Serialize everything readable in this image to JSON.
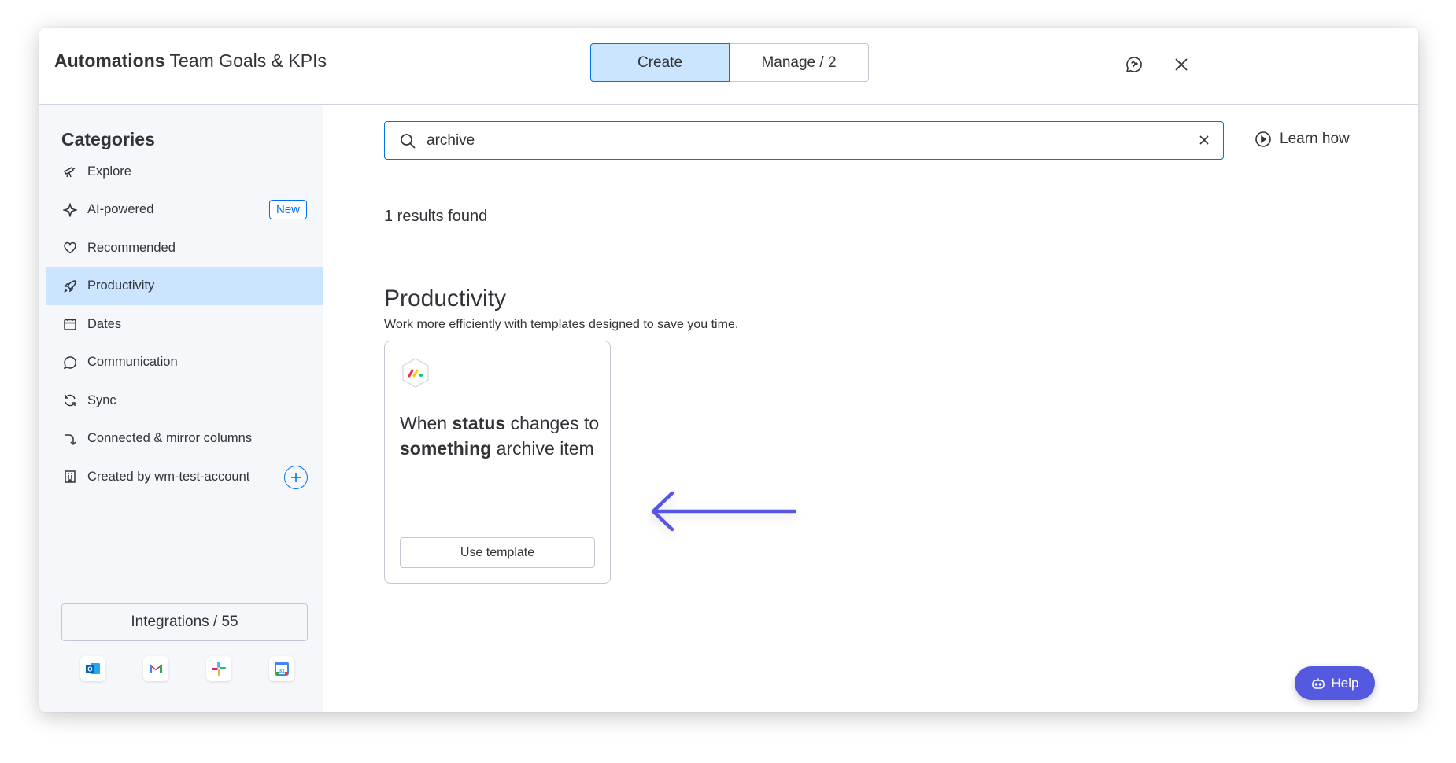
{
  "header": {
    "title_bold": "Automations",
    "title_board": "Team Goals & KPIs",
    "tabs": [
      {
        "label": "Create"
      },
      {
        "label": "Manage / 2"
      }
    ]
  },
  "sidebar": {
    "title": "Categories",
    "items": [
      {
        "label": "Explore",
        "icon": "telescope-icon"
      },
      {
        "label": "AI-powered",
        "icon": "sparkle-icon",
        "badge": "New"
      },
      {
        "label": "Recommended",
        "icon": "heart-icon"
      },
      {
        "label": "Productivity",
        "icon": "rocket-icon",
        "selected": true
      },
      {
        "label": "Dates",
        "icon": "calendar-icon"
      },
      {
        "label": "Communication",
        "icon": "chat-icon"
      },
      {
        "label": "Sync",
        "icon": "sync-icon"
      },
      {
        "label": "Connected & mirror columns",
        "icon": "connected-icon"
      },
      {
        "label": "Created by wm-test-account",
        "icon": "building-icon"
      }
    ],
    "integrations_label": "Integrations / 55",
    "integration_apps": [
      "outlook-icon",
      "gmail-icon",
      "slack-icon",
      "google-calendar-icon"
    ]
  },
  "search": {
    "value": "archive",
    "placeholder": ""
  },
  "learn_how": "Learn how",
  "results_text": "1 results found",
  "section": {
    "title": "Productivity",
    "description": "Work more efficiently with templates designed to save you time."
  },
  "template_card": {
    "parts": [
      "When ",
      "status",
      " changes to ",
      "something",
      " archive item"
    ],
    "button_label": "Use template"
  },
  "help_label": "Help",
  "colors": {
    "primary": "#0073ea",
    "selected_bg": "#cce5ff",
    "sidebar_bg": "#f6f7fb",
    "help_bg": "#5559df"
  }
}
